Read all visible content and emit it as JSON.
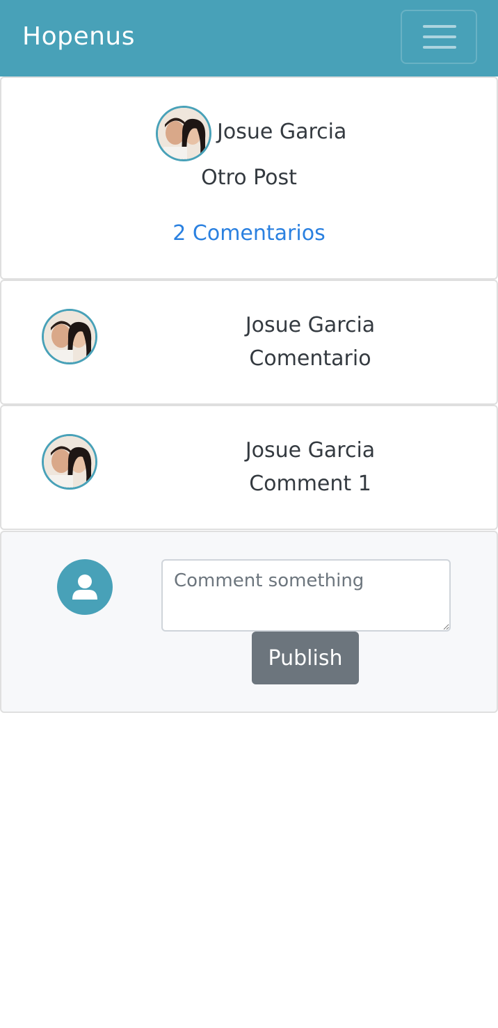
{
  "navbar": {
    "brand": "Hopenus",
    "menu_icon": "hamburger-menu-icon"
  },
  "post": {
    "author": "Josue Garcia",
    "text": "Otro Post",
    "comments_link": "2 Comentarios"
  },
  "comments": [
    {
      "author": "Josue Garcia",
      "text": "Comentario"
    },
    {
      "author": "Josue Garcia",
      "text": "Comment 1"
    }
  ],
  "comment_form": {
    "avatar_icon": "user-icon",
    "placeholder": "Comment something",
    "value": "",
    "publish_label": "Publish"
  },
  "colors": {
    "primary": "#48a1b8",
    "link": "#2a80e0",
    "button": "#6c757d"
  }
}
